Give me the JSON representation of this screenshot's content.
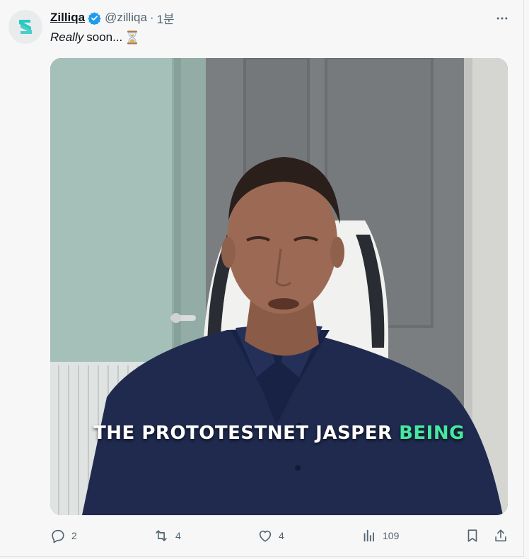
{
  "tweet": {
    "author_name": "Zilliqa",
    "handle": "@zilliqa",
    "separator": "·",
    "time": "1분",
    "text_emphasis": "Really",
    "text_rest": "soon...",
    "emoji_icon": "hourglass-icon",
    "media": {
      "caption_white": "THE PROTOTESTNET JASPER",
      "caption_green": "BEING",
      "caption_green_color": "#45e8a0"
    },
    "actions": {
      "replies": "2",
      "reposts": "4",
      "likes": "4",
      "views": "109"
    }
  },
  "colors": {
    "text_primary": "#0f1419",
    "text_secondary": "#536471",
    "verified_blue": "#1d9bf0",
    "logo_teal": "#29c9c1"
  },
  "icons": [
    "zilliqa-logo-icon",
    "verified-badge-icon",
    "more-icon",
    "reply-icon",
    "repost-icon",
    "like-icon",
    "views-icon",
    "bookmark-icon",
    "share-icon"
  ]
}
